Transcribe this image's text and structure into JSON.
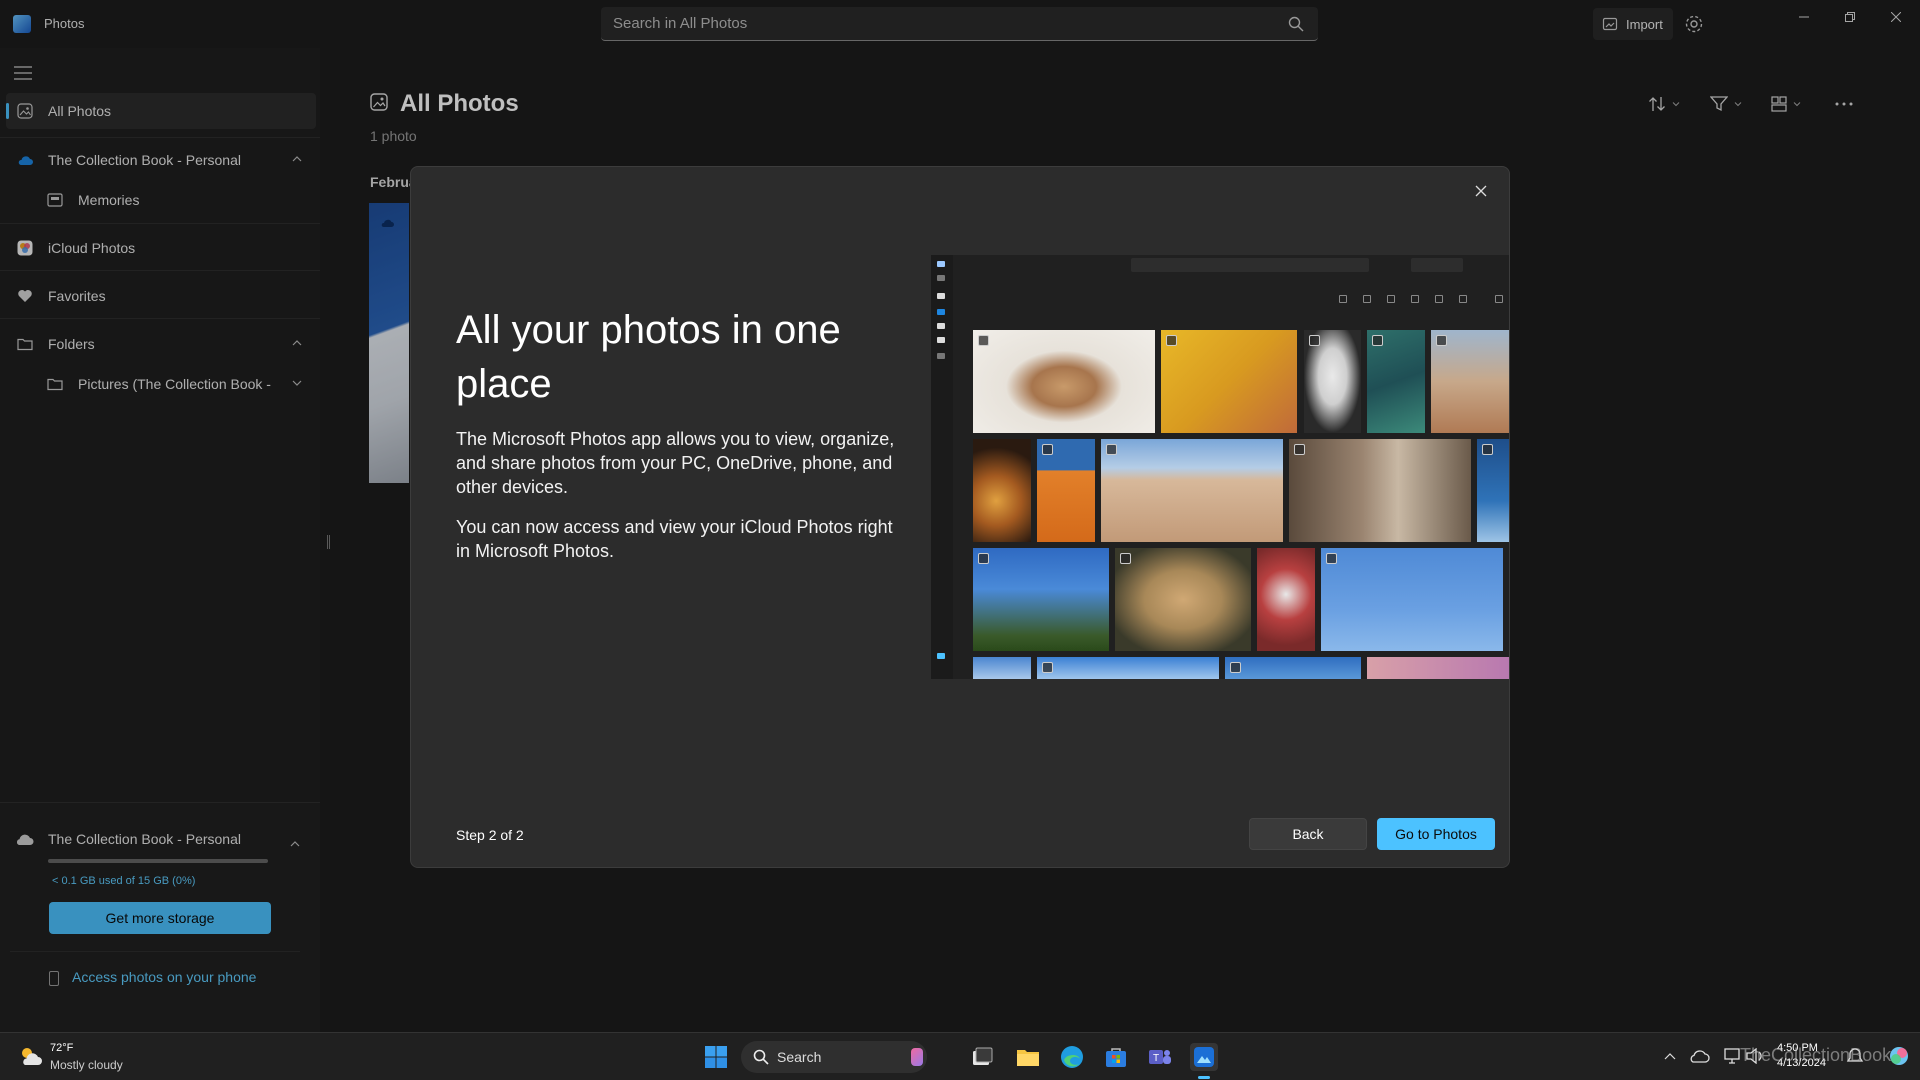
{
  "app": {
    "title": "Photos"
  },
  "search": {
    "placeholder": "Search in All Photos"
  },
  "toolbar": {
    "import_label": "Import"
  },
  "sidebar": {
    "items": [
      {
        "label": "All Photos",
        "icon": "photos-icon",
        "selected": true
      },
      {
        "label": "The Collection Book - Personal",
        "icon": "onedrive-cloud-icon",
        "expanded": true
      },
      {
        "label": "Memories",
        "icon": "memories-icon"
      },
      {
        "label": "iCloud Photos",
        "icon": "icloud-icon"
      },
      {
        "label": "Favorites",
        "icon": "heart-icon"
      },
      {
        "label": "Folders",
        "icon": "folder-icon",
        "expanded": true
      },
      {
        "label": "Pictures (The Collection Book -",
        "icon": "folder-icon"
      }
    ],
    "storage": {
      "account": "The Collection Book - Personal",
      "usage_text": "< 0.1 GB used of 15 GB (0%)",
      "usage_fraction": 0.0,
      "button_label": "Get more storage",
      "phone_link": "Access photos on your phone"
    }
  },
  "main": {
    "title": "All Photos",
    "count": "1 photo",
    "group_label": "Februa"
  },
  "dialog": {
    "heading": "All your photos in one place",
    "paragraph1": "The Microsoft Photos app allows you to view, organize, and share photos from your PC, OneDrive, phone, and other devices.",
    "paragraph2": "You can now access and view your iCloud Photos right in Microsoft Photos.",
    "step": "Step 2 of 2",
    "back_label": "Back",
    "primary_label": "Go to Photos"
  },
  "taskbar": {
    "weather_temp": "72°F",
    "weather_desc": "Mostly cloudy",
    "search_label": "Search",
    "time": "4:50 PM",
    "date": "4/13/2024",
    "watermark": "TheCollectionBook"
  },
  "colors": {
    "accent": "#4cc2ff",
    "background": "#1c1c1c",
    "dialog": "#2c2c2c"
  }
}
